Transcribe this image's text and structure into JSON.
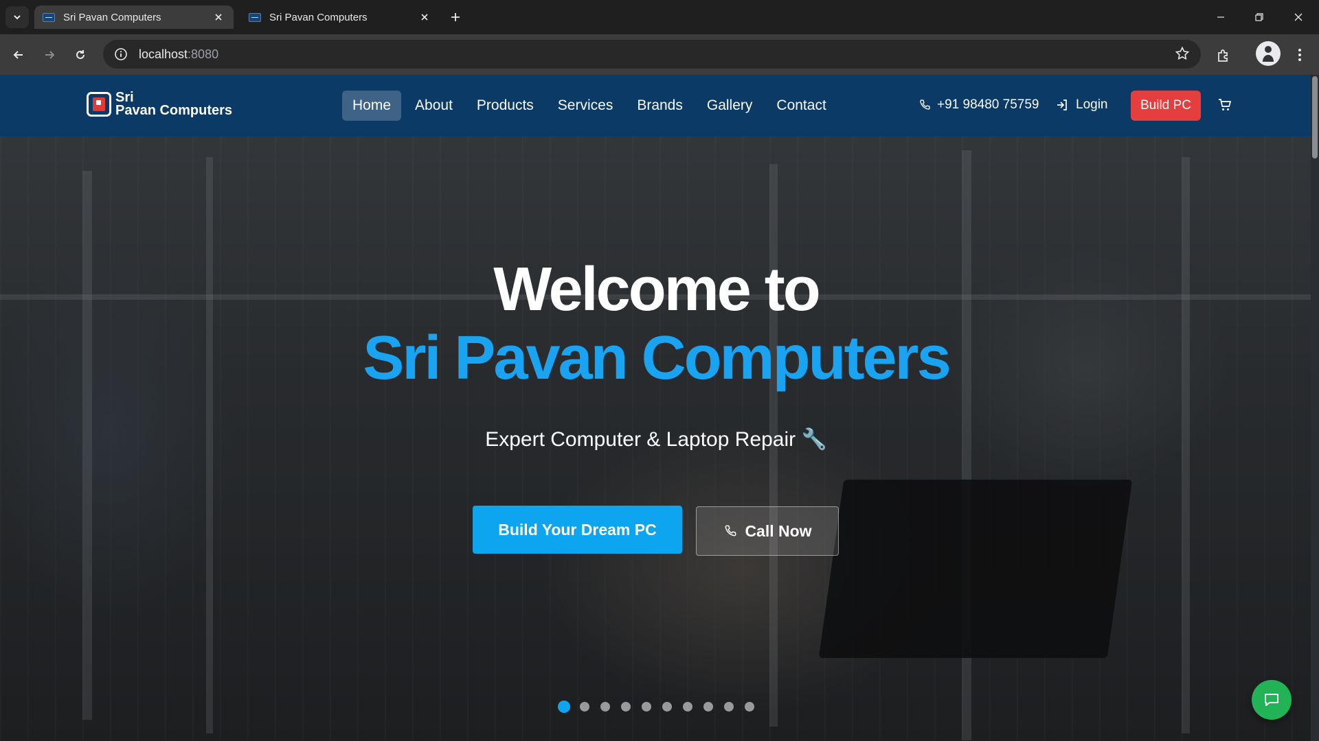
{
  "browser": {
    "tabs": [
      {
        "title": "Sri Pavan Computers",
        "active": true
      },
      {
        "title": "Sri Pavan Computers",
        "active": false
      }
    ],
    "address": {
      "host": "localhost",
      "port": ":8080"
    }
  },
  "site": {
    "logo": {
      "line1": "Sri",
      "line2": "Pavan Computers"
    },
    "nav": [
      "Home",
      "About",
      "Products",
      "Services",
      "Brands",
      "Gallery",
      "Contact"
    ],
    "active_nav": "Home",
    "phone": "+91 98480 75759",
    "login_label": "Login",
    "build_pc_label": "Build PC",
    "hero": {
      "title_line1": "Welcome to",
      "title_line2": "Sri Pavan Computers",
      "subtitle": "Expert Computer & Laptop Repair 🔧",
      "primary_cta": "Build Your Dream PC",
      "secondary_cta": "Call Now",
      "slide_count": 10,
      "current_slide": 1
    }
  },
  "colors": {
    "navbar": "#0b3a66",
    "accent_blue": "#1aa3f0",
    "build_pc_red": "#e53e3e",
    "chat_green": "#22b357"
  }
}
